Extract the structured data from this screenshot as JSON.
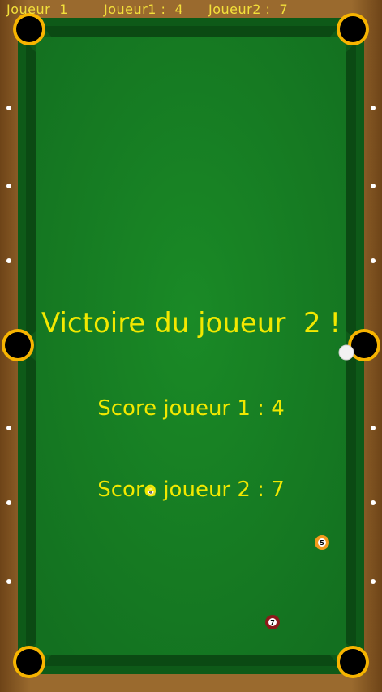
{
  "hud": {
    "current_player": "Joueur  1",
    "player1_score": "Joueur1 :  4",
    "player2_score": "Joueur2 :  7"
  },
  "result": {
    "victory_message": "Victoire du joueur  2 !",
    "score_player1": "Score joueur 1 : 4",
    "score_player2": "Score joueur 2 : 7"
  },
  "balls": [
    {
      "id": "cue-ball",
      "label": "",
      "color": "#f2f2f2"
    },
    {
      "id": "ball-5",
      "label": "5",
      "color": "#f39a1b"
    },
    {
      "id": "ball-7",
      "label": "7",
      "color": "#8b1a1a"
    },
    {
      "id": "ball-8",
      "label": "8",
      "color": "#f0e020"
    }
  ],
  "colors": {
    "felt": "#167a22",
    "felt_edge": "#0c4d14",
    "rail": "#8a5a24",
    "pocket_rim": "#f7b400",
    "text": "#f2e800"
  }
}
